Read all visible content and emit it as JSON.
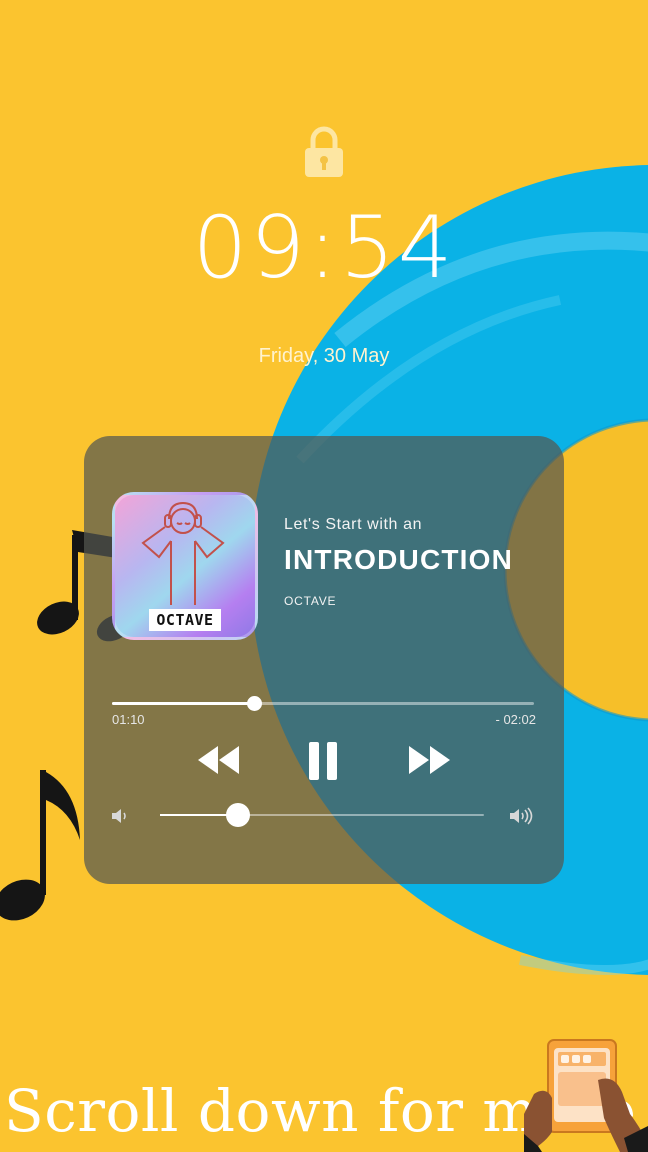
{
  "lockscreen": {
    "time": "09:54",
    "date": "Friday, 30 May"
  },
  "player": {
    "subtitle": "Let's Start with an",
    "title": "INTRODUCTION",
    "artist": "OCTAVE",
    "album_label": "OCTAVE",
    "elapsed": "01:10",
    "remaining": "- 02:02",
    "progress_fraction": 0.337,
    "volume_fraction": 0.24,
    "controls": [
      "rewind-icon",
      "pause-icon",
      "fast-forward-icon"
    ]
  },
  "footer": {
    "scroll_hint": "Scroll down for more"
  },
  "colors": {
    "background": "#fbc42f",
    "vinyl": "#08b4e8",
    "player_panel": "#55584f"
  }
}
